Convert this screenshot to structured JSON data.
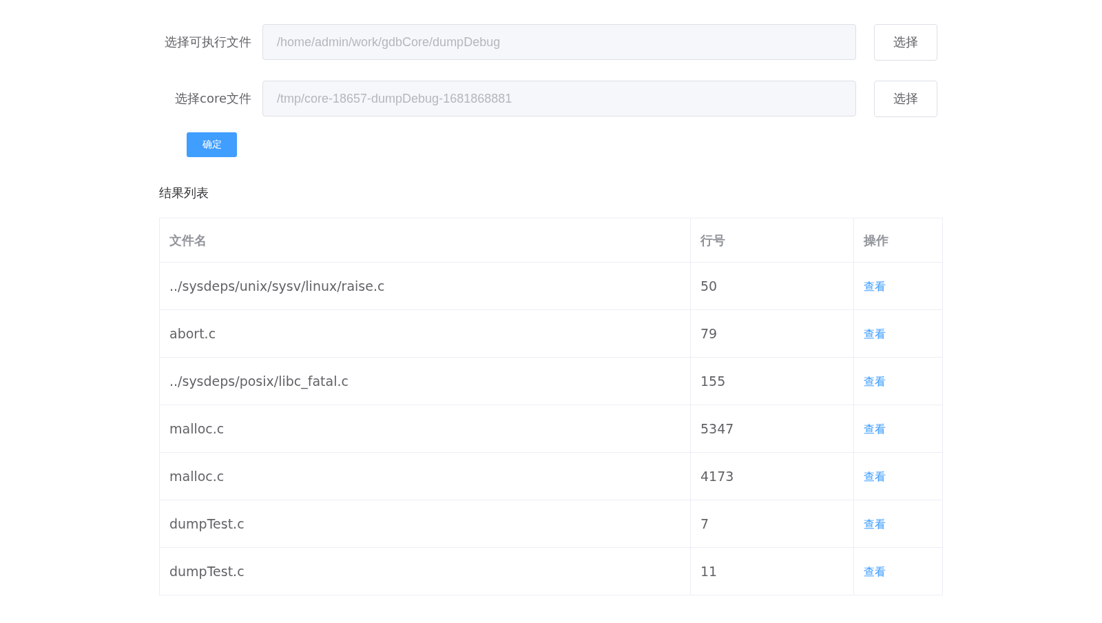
{
  "form": {
    "fields": [
      {
        "label": "选择可执行文件",
        "value": "/home/admin/work/gdbCore/dumpDebug",
        "disabled": true,
        "button": "选择"
      },
      {
        "label": "选择core文件",
        "value": "/tmp/core-18657-dumpDebug-1681868881",
        "disabled": true,
        "button": "选择"
      }
    ],
    "submit": "确定"
  },
  "results": {
    "title": "结果列表",
    "columns": [
      "文件名",
      "行号",
      "操作"
    ],
    "rows": [
      {
        "file": "../sysdeps/unix/sysv/linux/raise.c",
        "line": "50",
        "action": "查看"
      },
      {
        "file": "abort.c",
        "line": "79",
        "action": "查看"
      },
      {
        "file": "../sysdeps/posix/libc_fatal.c",
        "line": "155",
        "action": "查看"
      },
      {
        "file": "malloc.c",
        "line": "5347",
        "action": "查看"
      },
      {
        "file": "malloc.c",
        "line": "4173",
        "action": "查看"
      },
      {
        "file": "dumpTest.c",
        "line": "7",
        "action": "查看"
      },
      {
        "file": "dumpTest.c",
        "line": "11",
        "action": "查看"
      }
    ]
  }
}
